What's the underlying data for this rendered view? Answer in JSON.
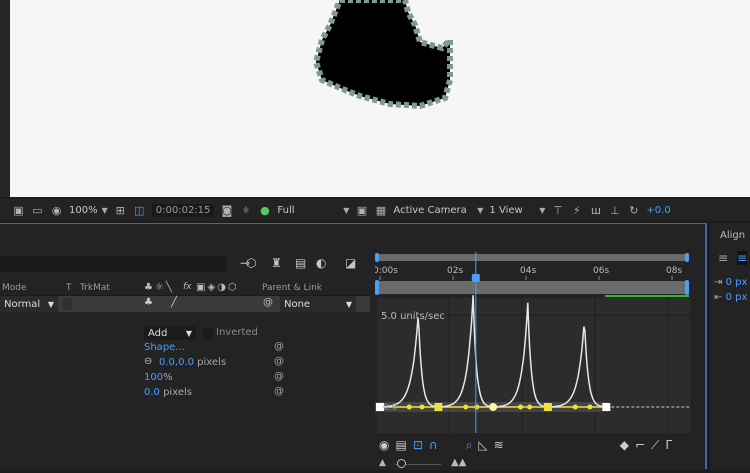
{
  "viewer": {
    "toolbar": {
      "zoom": "100%",
      "timecode": "0:00:02:15",
      "resolution": "Full",
      "camera": "Active Camera",
      "views": "1 View",
      "exposure": "+0.0"
    }
  },
  "timeline": {
    "columns": {
      "mode": "Mode",
      "t": "T",
      "trkmat": "TrkMat",
      "fx": "fx",
      "parent": "Parent & Link"
    },
    "layer": {
      "mode": "Normal",
      "parent": "None"
    },
    "mask": {
      "mode": "Add",
      "inverted_label": "Inverted",
      "inverted": false,
      "path": "Shape...",
      "feather_value": "0.0,0.0",
      "feather_unit": " pixels",
      "opacity_value": "100",
      "opacity_unit": "%",
      "expansion_value": "0.0",
      "expansion_unit": " pixels"
    },
    "ruler": {
      "labels": [
        "0:00s",
        "02s",
        "04s",
        "06s",
        "08s"
      ],
      "current_time_sec": 2.625
    },
    "graph": {
      "label_top": "5.0 units/sec",
      "label_zero": "0.0",
      "keyframes_sec": [
        0,
        1.6,
        3.1,
        4.6,
        6.2
      ],
      "peaks": [
        {
          "t": 1.05,
          "speed": 5.0
        },
        {
          "t": 2.55,
          "speed": 5.9
        },
        {
          "t": 4.05,
          "speed": 5.5
        },
        {
          "t": 5.6,
          "speed": 4.6
        }
      ]
    }
  },
  "align_panel": {
    "title": "Align",
    "values": [
      "0 px",
      "0 px"
    ]
  },
  "colors": {
    "accent": "#4a9eff",
    "keyframe": "#f2e03a",
    "panel_border": "#3d6ca3",
    "work_area": "#2fb82f"
  }
}
